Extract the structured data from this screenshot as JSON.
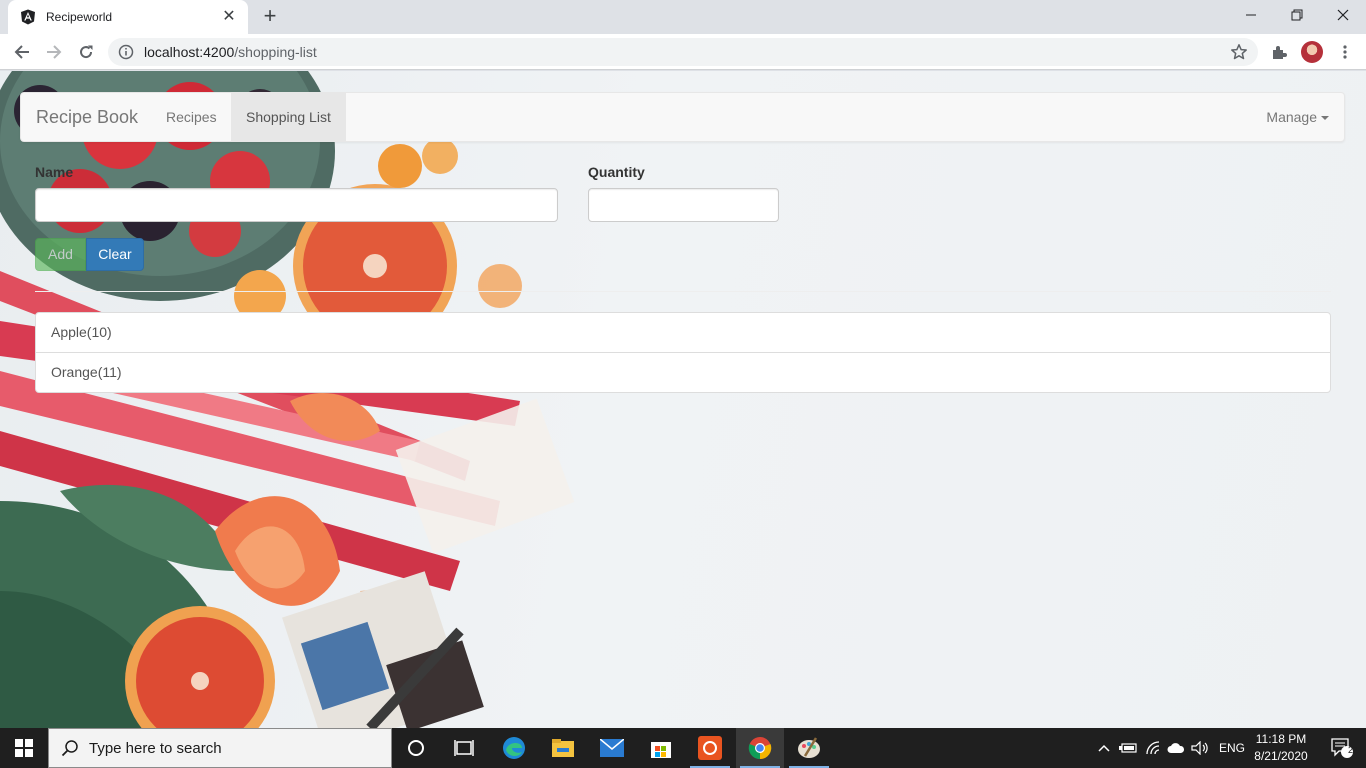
{
  "browser": {
    "tab_title": "Recipeworld",
    "tab_close_glyph": "✕",
    "new_tab_glyph": "+",
    "url_host": "localhost:4200",
    "url_path": "/shopping-list"
  },
  "app": {
    "brand": "Recipe Book",
    "nav": {
      "recipes": "Recipes",
      "shopping_list": "Shopping List",
      "manage": "Manage"
    }
  },
  "form": {
    "name_label": "Name",
    "name_value": "",
    "quantity_label": "Quantity",
    "quantity_value": "",
    "add_label": "Add",
    "clear_label": "Clear"
  },
  "shopping_list": {
    "items": [
      {
        "label": "Apple(10)"
      },
      {
        "label": "Orange(11)"
      }
    ]
  },
  "taskbar": {
    "search_placeholder": "Type here to search",
    "language": "ENG",
    "time": "11:18 PM",
    "date": "8/21/2020",
    "notification_count": "21"
  },
  "colors": {
    "navbar_bg": "#f8f8f8",
    "btn_success": "#5cb85c",
    "btn_primary": "#337ab7",
    "taskbar_bg": "#1f1f1f"
  },
  "icons": [
    "angular-icon",
    "back-arrow-icon",
    "forward-arrow-icon",
    "reload-icon",
    "info-icon",
    "star-icon",
    "extensions-icon",
    "profile-avatar",
    "menu-dots-icon",
    "windows-start-icon",
    "search-icon",
    "cortana-icon",
    "task-view-icon",
    "edge-icon",
    "file-explorer-icon",
    "mail-icon",
    "store-icon",
    "ubuntu-icon",
    "chrome-icon",
    "paint-icon",
    "chevron-up-icon",
    "battery-icon",
    "wifi-icon",
    "onedrive-icon",
    "volume-icon",
    "notification-icon"
  ]
}
